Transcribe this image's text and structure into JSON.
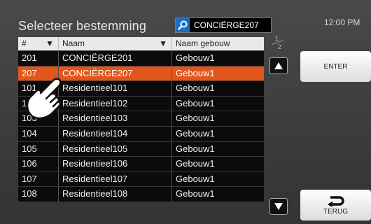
{
  "header": {
    "title": "Selecteer bestemming",
    "search_value": "CONCIËRGE207",
    "time": "12:00 PM"
  },
  "table": {
    "columns": [
      {
        "label": "#",
        "sortable": true
      },
      {
        "label": "Naam",
        "sortable": true
      },
      {
        "label": "Naam gebouw",
        "sortable": false
      }
    ],
    "rows": [
      {
        "num": "201",
        "name": "CONCIËRGE201",
        "building": "Gebouw1",
        "selected": false
      },
      {
        "num": "207",
        "name": "CONCIËRGE207",
        "building": "Gebouw1",
        "selected": true
      },
      {
        "num": "101",
        "name": "Residentieel101",
        "building": "Gebouw1",
        "selected": false
      },
      {
        "num": "102",
        "name": "Residentieel102",
        "building": "Gebouw1",
        "selected": false
      },
      {
        "num": "103",
        "name": "Residentieel103",
        "building": "Gebouw1",
        "selected": false
      },
      {
        "num": "104",
        "name": "Residentieel104",
        "building": "Gebouw1",
        "selected": false
      },
      {
        "num": "105",
        "name": "Residentieel105",
        "building": "Gebouw1",
        "selected": false
      },
      {
        "num": "106",
        "name": "Residentieel106",
        "building": "Gebouw1",
        "selected": false
      },
      {
        "num": "107",
        "name": "Residentieel107",
        "building": "Gebouw1",
        "selected": false
      },
      {
        "num": "108",
        "name": "Residentieel108",
        "building": "Gebouw1",
        "selected": false
      }
    ]
  },
  "pager": {
    "current": "1",
    "total": "2"
  },
  "buttons": {
    "enter_label": "ENTER",
    "back_label": "TERUG"
  },
  "colors": {
    "selected_row": "#e2551b",
    "search_icon_bg": "#1d6cc7"
  },
  "icons": {
    "search": "search-icon",
    "up": "arrow-up-icon",
    "down": "arrow-down-icon",
    "back": "return-arrow-icon",
    "hand": "pointing-hand-icon"
  }
}
